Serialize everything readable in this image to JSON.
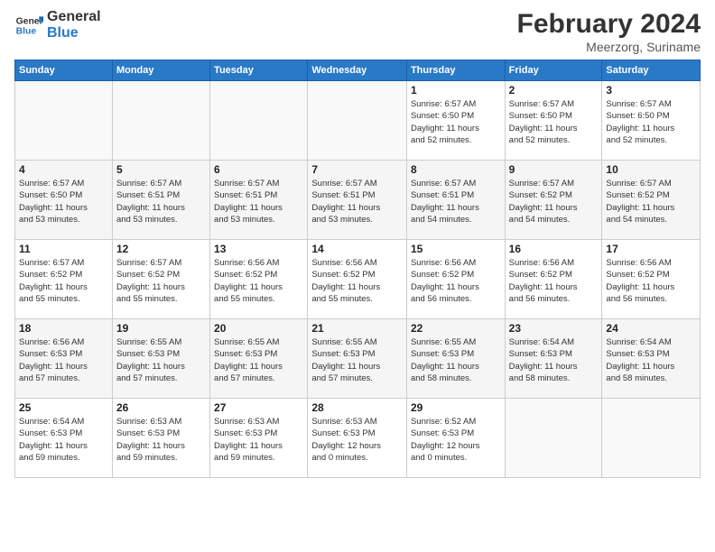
{
  "header": {
    "logo_line1": "General",
    "logo_line2": "Blue",
    "month": "February 2024",
    "location": "Meerzorg, Suriname"
  },
  "days_of_week": [
    "Sunday",
    "Monday",
    "Tuesday",
    "Wednesday",
    "Thursday",
    "Friday",
    "Saturday"
  ],
  "weeks": [
    [
      {
        "day": "",
        "info": ""
      },
      {
        "day": "",
        "info": ""
      },
      {
        "day": "",
        "info": ""
      },
      {
        "day": "",
        "info": ""
      },
      {
        "day": "1",
        "info": "Sunrise: 6:57 AM\nSunset: 6:50 PM\nDaylight: 11 hours\nand 52 minutes."
      },
      {
        "day": "2",
        "info": "Sunrise: 6:57 AM\nSunset: 6:50 PM\nDaylight: 11 hours\nand 52 minutes."
      },
      {
        "day": "3",
        "info": "Sunrise: 6:57 AM\nSunset: 6:50 PM\nDaylight: 11 hours\nand 52 minutes."
      }
    ],
    [
      {
        "day": "4",
        "info": "Sunrise: 6:57 AM\nSunset: 6:50 PM\nDaylight: 11 hours\nand 53 minutes."
      },
      {
        "day": "5",
        "info": "Sunrise: 6:57 AM\nSunset: 6:51 PM\nDaylight: 11 hours\nand 53 minutes."
      },
      {
        "day": "6",
        "info": "Sunrise: 6:57 AM\nSunset: 6:51 PM\nDaylight: 11 hours\nand 53 minutes."
      },
      {
        "day": "7",
        "info": "Sunrise: 6:57 AM\nSunset: 6:51 PM\nDaylight: 11 hours\nand 53 minutes."
      },
      {
        "day": "8",
        "info": "Sunrise: 6:57 AM\nSunset: 6:51 PM\nDaylight: 11 hours\nand 54 minutes."
      },
      {
        "day": "9",
        "info": "Sunrise: 6:57 AM\nSunset: 6:52 PM\nDaylight: 11 hours\nand 54 minutes."
      },
      {
        "day": "10",
        "info": "Sunrise: 6:57 AM\nSunset: 6:52 PM\nDaylight: 11 hours\nand 54 minutes."
      }
    ],
    [
      {
        "day": "11",
        "info": "Sunrise: 6:57 AM\nSunset: 6:52 PM\nDaylight: 11 hours\nand 55 minutes."
      },
      {
        "day": "12",
        "info": "Sunrise: 6:57 AM\nSunset: 6:52 PM\nDaylight: 11 hours\nand 55 minutes."
      },
      {
        "day": "13",
        "info": "Sunrise: 6:56 AM\nSunset: 6:52 PM\nDaylight: 11 hours\nand 55 minutes."
      },
      {
        "day": "14",
        "info": "Sunrise: 6:56 AM\nSunset: 6:52 PM\nDaylight: 11 hours\nand 55 minutes."
      },
      {
        "day": "15",
        "info": "Sunrise: 6:56 AM\nSunset: 6:52 PM\nDaylight: 11 hours\nand 56 minutes."
      },
      {
        "day": "16",
        "info": "Sunrise: 6:56 AM\nSunset: 6:52 PM\nDaylight: 11 hours\nand 56 minutes."
      },
      {
        "day": "17",
        "info": "Sunrise: 6:56 AM\nSunset: 6:52 PM\nDaylight: 11 hours\nand 56 minutes."
      }
    ],
    [
      {
        "day": "18",
        "info": "Sunrise: 6:56 AM\nSunset: 6:53 PM\nDaylight: 11 hours\nand 57 minutes."
      },
      {
        "day": "19",
        "info": "Sunrise: 6:55 AM\nSunset: 6:53 PM\nDaylight: 11 hours\nand 57 minutes."
      },
      {
        "day": "20",
        "info": "Sunrise: 6:55 AM\nSunset: 6:53 PM\nDaylight: 11 hours\nand 57 minutes."
      },
      {
        "day": "21",
        "info": "Sunrise: 6:55 AM\nSunset: 6:53 PM\nDaylight: 11 hours\nand 57 minutes."
      },
      {
        "day": "22",
        "info": "Sunrise: 6:55 AM\nSunset: 6:53 PM\nDaylight: 11 hours\nand 58 minutes."
      },
      {
        "day": "23",
        "info": "Sunrise: 6:54 AM\nSunset: 6:53 PM\nDaylight: 11 hours\nand 58 minutes."
      },
      {
        "day": "24",
        "info": "Sunrise: 6:54 AM\nSunset: 6:53 PM\nDaylight: 11 hours\nand 58 minutes."
      }
    ],
    [
      {
        "day": "25",
        "info": "Sunrise: 6:54 AM\nSunset: 6:53 PM\nDaylight: 11 hours\nand 59 minutes."
      },
      {
        "day": "26",
        "info": "Sunrise: 6:53 AM\nSunset: 6:53 PM\nDaylight: 11 hours\nand 59 minutes."
      },
      {
        "day": "27",
        "info": "Sunrise: 6:53 AM\nSunset: 6:53 PM\nDaylight: 11 hours\nand 59 minutes."
      },
      {
        "day": "28",
        "info": "Sunrise: 6:53 AM\nSunset: 6:53 PM\nDaylight: 12 hours\nand 0 minutes."
      },
      {
        "day": "29",
        "info": "Sunrise: 6:52 AM\nSunset: 6:53 PM\nDaylight: 12 hours\nand 0 minutes."
      },
      {
        "day": "",
        "info": ""
      },
      {
        "day": "",
        "info": ""
      }
    ]
  ]
}
